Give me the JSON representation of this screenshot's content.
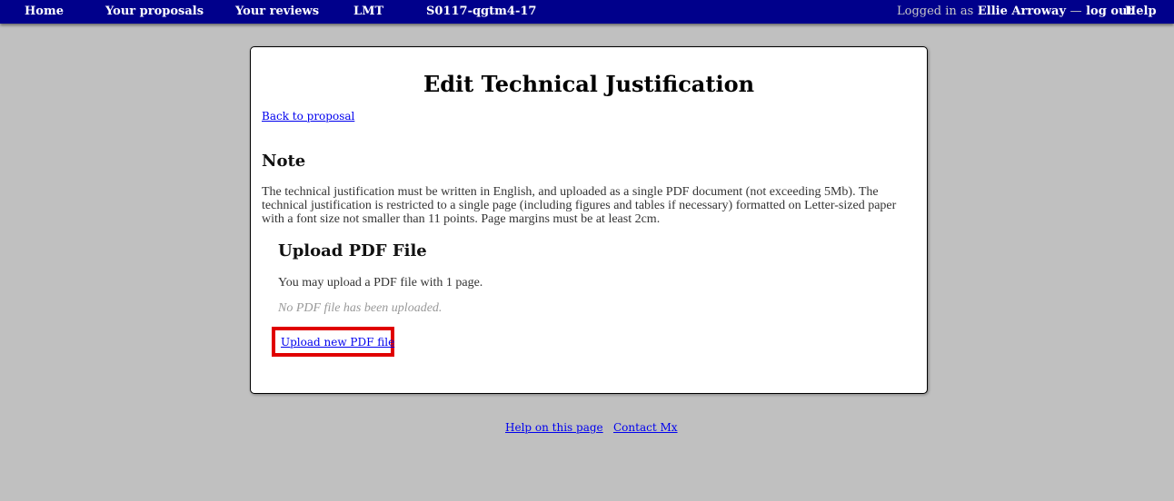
{
  "nav": {
    "home": "Home",
    "your_proposals": "Your proposals",
    "your_reviews": "Your reviews",
    "lmt": "LMT",
    "proposal_code": "S0117-qgtm4-17",
    "logged_in_prefix": "Logged in as",
    "user_name": "Ellie Arroway",
    "dash": "—",
    "log_out": "log out",
    "help": "Help"
  },
  "main": {
    "title": "Edit Technical Justification",
    "back_link": "Back to proposal",
    "note_heading": "Note",
    "note_text": "The technical justification must be written in English, and uploaded as a single PDF document (not exceeding 5Mb). The technical justification is restricted to a single page (including figures and tables if necessary) formatted on Letter-sized paper with a font size not smaller than 11 points. Page margins must be at least 2cm.",
    "upload_heading": "Upload PDF File",
    "upload_info": "You may upload a PDF file with 1 page.",
    "no_file_text": "No PDF file has been uploaded.",
    "upload_link": "Upload new PDF file"
  },
  "footer": {
    "help_link": "Help on this page",
    "contact_link": "Contact Mx"
  },
  "colors": {
    "navbar_bg": "#00008b",
    "page_bg": "#c0c0c0",
    "link": "#0000ee",
    "highlight_border": "#e00000"
  }
}
